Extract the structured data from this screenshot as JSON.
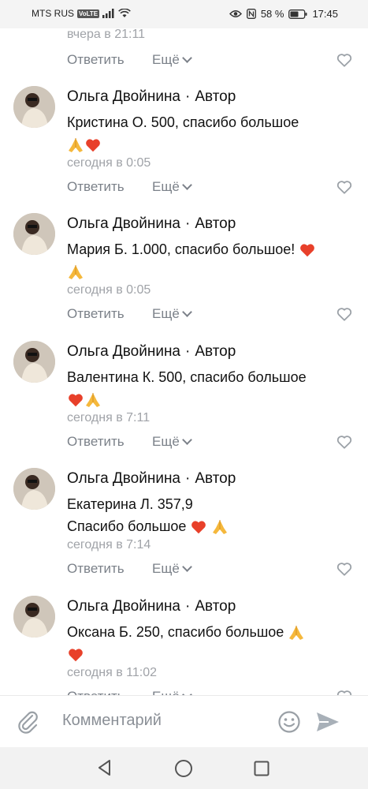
{
  "status_bar": {
    "carrier": "MTS RUS",
    "vk_badge": "VoLTE",
    "battery_percent": "58 %",
    "time": "17:45"
  },
  "top_fragment": {
    "time": "вчера в 21:11",
    "reply_label": "Ответить",
    "more_label": "Ещё"
  },
  "comments": [
    {
      "author": "Ольга Двойнина",
      "role": "Автор",
      "line1": "Кристина О. 500, спасибо большое",
      "line2": "",
      "time": "сегодня в 0:05",
      "reply_label": "Ответить",
      "more_label": "Ещё"
    },
    {
      "author": "Ольга Двойнина",
      "role": "Автор",
      "line1": "Мария Б. 1.000, спасибо большое!",
      "line2": "",
      "time": "сегодня в 0:05",
      "reply_label": "Ответить",
      "more_label": "Ещё"
    },
    {
      "author": "Ольга Двойнина",
      "role": "Автор",
      "line1": "Валентина К. 500, спасибо большое",
      "line2": "",
      "time": "сегодня в 7:11",
      "reply_label": "Ответить",
      "more_label": "Ещё"
    },
    {
      "author": "Ольга Двойнина",
      "role": "Автор",
      "line1": "Екатерина Л. 357,9",
      "line2": "Спасибо большое",
      "time": "сегодня в 7:14",
      "reply_label": "Ответить",
      "more_label": "Ещё"
    },
    {
      "author": "Ольга Двойнина",
      "role": "Автор",
      "line1": "Оксана Б. 250, спасибо большое",
      "line2": "",
      "time": "сегодня в 11:02",
      "reply_label": "Ответить",
      "more_label": "Ещё"
    }
  ],
  "input": {
    "placeholder": "Комментарий"
  },
  "icons": {
    "like": "heart-outline-icon",
    "attach": "paperclip-icon",
    "emoji": "smile-icon",
    "send": "send-icon",
    "heart_emoji": "red-heart-emoji",
    "pray_emoji": "folded-hands-emoji"
  },
  "colors": {
    "heart": "#e8402a",
    "action_text": "#7b8189",
    "time_text": "#a0a3a8"
  }
}
